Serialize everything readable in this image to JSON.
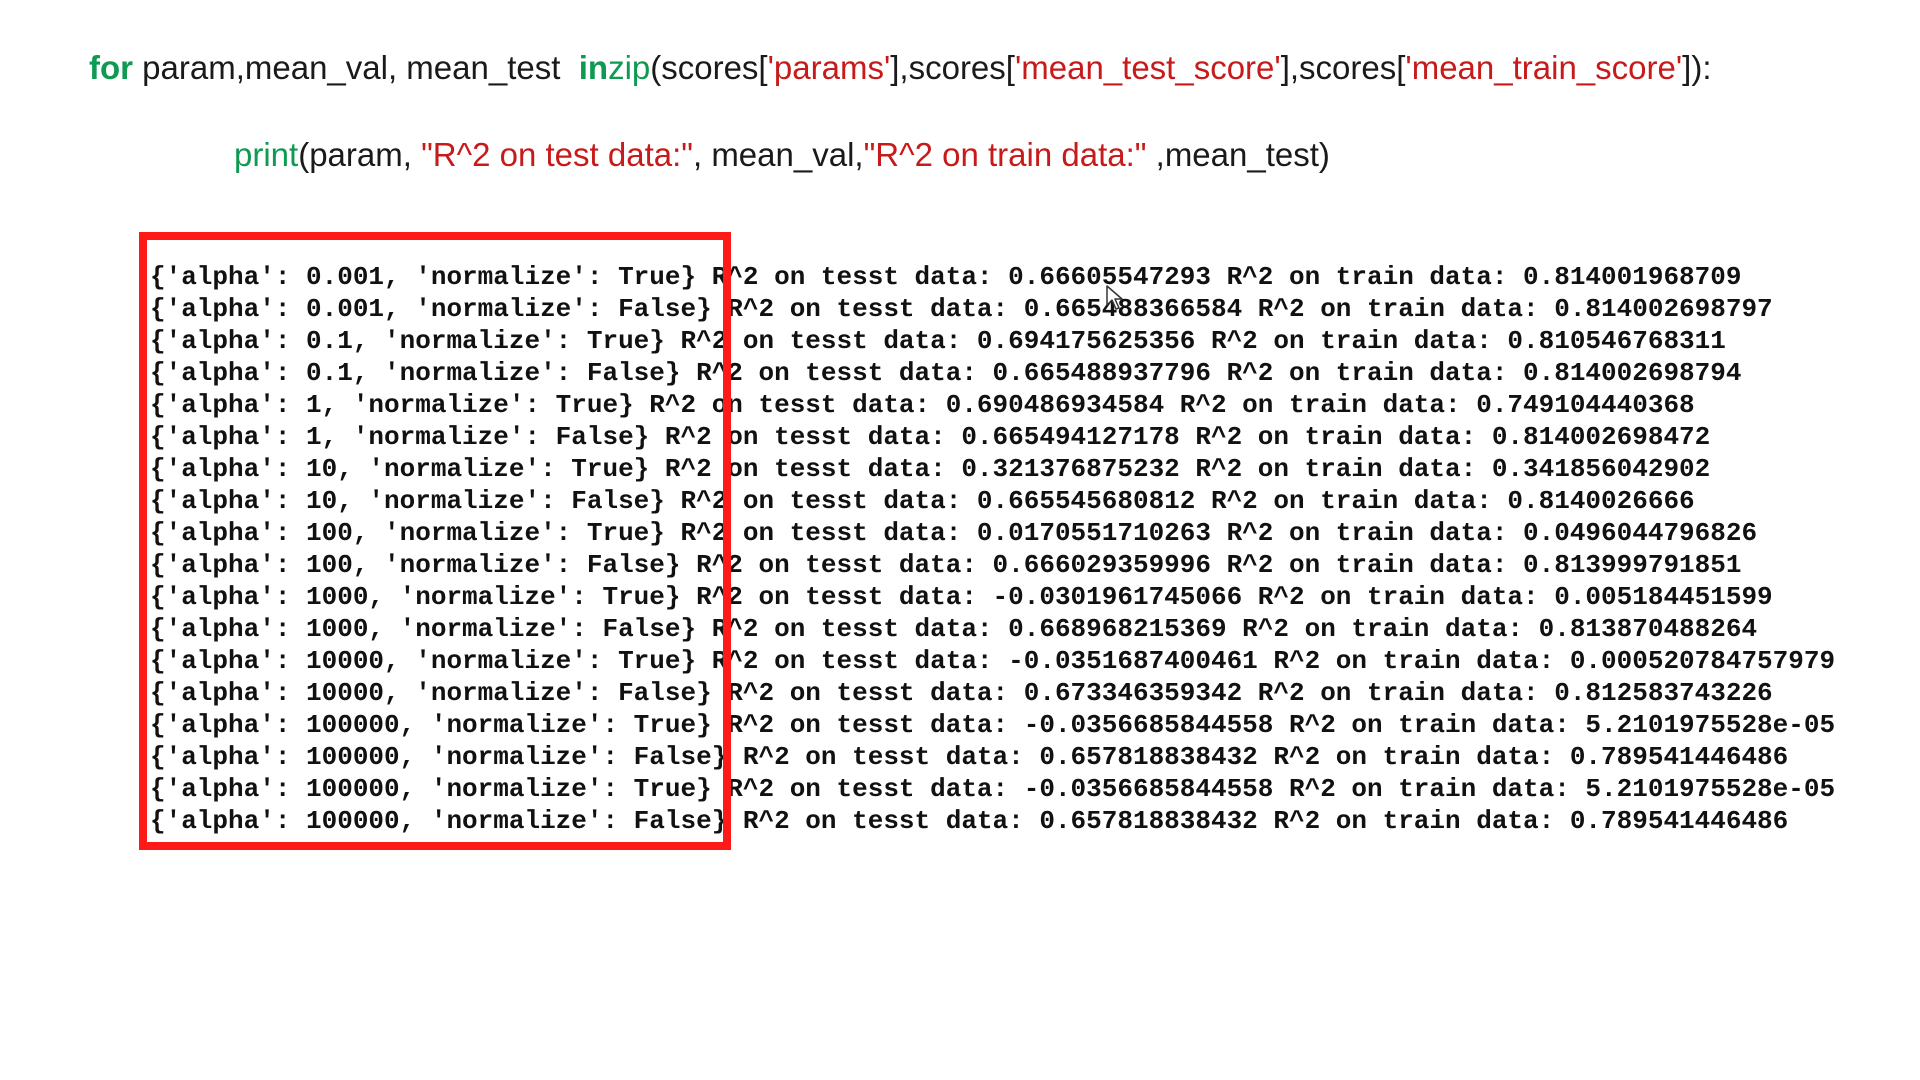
{
  "code": {
    "line1": {
      "kw_for": "for",
      "vars": " param,mean_val, mean_test  ",
      "kw_in": "in",
      "fn_zip": "zip",
      "p1": "(scores[",
      "s1": "'params'",
      "p2": "],scores[",
      "s2": "'mean_test_score'",
      "p3": "],scores[",
      "s3": "'mean_train_score'",
      "p4": "]):"
    },
    "line2": {
      "fn_print": "print",
      "p1": "(param, ",
      "s1": "\"R^2 on test data:\"",
      "p2": ", mean_val,",
      "s2": "\"R^2 on train data:\"",
      "p3": " ,mean_test)"
    }
  },
  "output_lines": [
    "{'alpha': 0.001, 'normalize': True} R^2 on tesst data: 0.66605547293 R^2 on train data: 0.814001968709",
    "{'alpha': 0.001, 'normalize': False} R^2 on tesst data: 0.665488366584 R^2 on train data: 0.814002698797",
    "{'alpha': 0.1, 'normalize': True} R^2 on tesst data: 0.694175625356 R^2 on train data: 0.810546768311",
    "{'alpha': 0.1, 'normalize': False} R^2 on tesst data: 0.665488937796 R^2 on train data: 0.814002698794",
    "{'alpha': 1, 'normalize': True} R^2 on tesst data: 0.690486934584 R^2 on train data: 0.749104440368",
    "{'alpha': 1, 'normalize': False} R^2 on tesst data: 0.665494127178 R^2 on train data: 0.814002698472",
    "{'alpha': 10, 'normalize': True} R^2 on tesst data: 0.321376875232 R^2 on train data: 0.341856042902",
    "{'alpha': 10, 'normalize': False} R^2 on tesst data: 0.665545680812 R^2 on train data: 0.8140026666",
    "{'alpha': 100, 'normalize': True} R^2 on tesst data: 0.0170551710263 R^2 on train data: 0.0496044796826",
    "{'alpha': 100, 'normalize': False} R^2 on tesst data: 0.666029359996 R^2 on train data: 0.813999791851",
    "{'alpha': 1000, 'normalize': True} R^2 on tesst data: -0.0301961745066 R^2 on train data: 0.005184451599",
    "{'alpha': 1000, 'normalize': False} R^2 on tesst data: 0.668968215369 R^2 on train data: 0.813870488264",
    "{'alpha': 10000, 'normalize': True} R^2 on tesst data: -0.0351687400461 R^2 on train data: 0.000520784757979",
    "{'alpha': 10000, 'normalize': False} R^2 on tesst data: 0.673346359342 R^2 on train data: 0.812583743226",
    "{'alpha': 100000, 'normalize': True} R^2 on tesst data: -0.0356685844558 R^2 on train data: 5.2101975528e-05",
    "{'alpha': 100000, 'normalize': False} R^2 on tesst data: 0.657818838432 R^2 on train data: 0.789541446486",
    "{'alpha': 100000, 'normalize': True} R^2 on tesst data: -0.0356685844558 R^2 on train data: 5.2101975528e-05",
    "{'alpha': 100000, 'normalize': False} R^2 on tesst data: 0.657818838432 R^2 on train data: 0.789541446486"
  ],
  "colors": {
    "keyword_green": "#0e9a52",
    "string_red": "#c71a1a",
    "highlight_border": "#ff1a1a"
  },
  "icons": {
    "cursor": "mouse-pointer-icon"
  }
}
